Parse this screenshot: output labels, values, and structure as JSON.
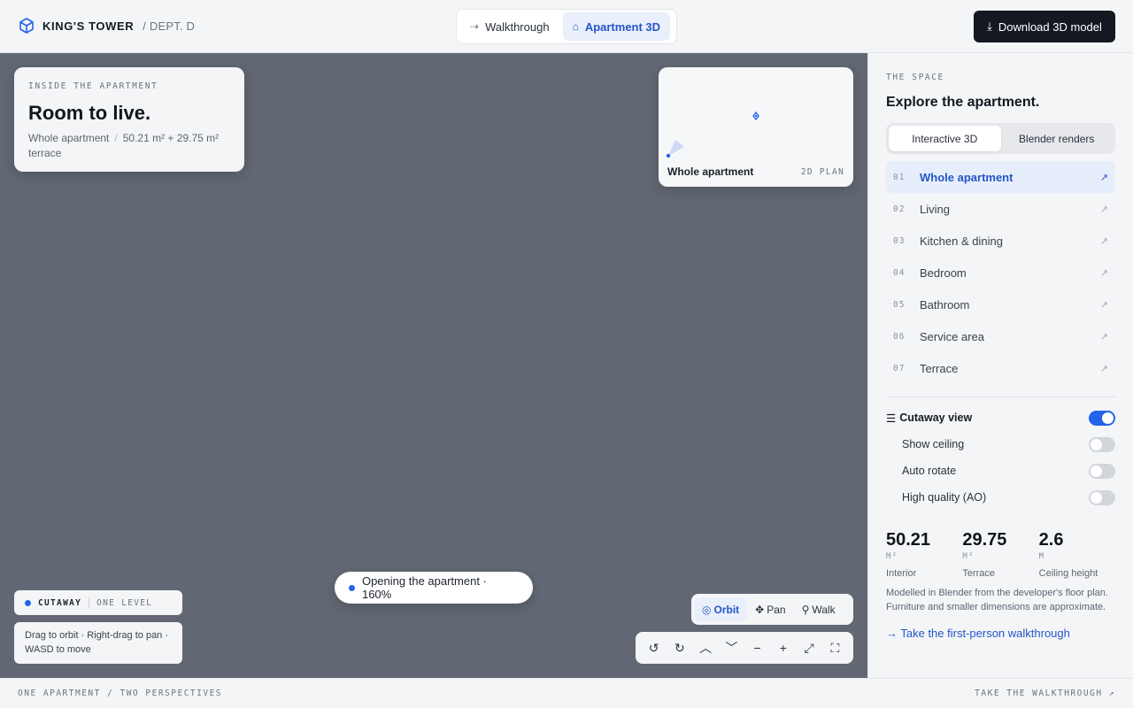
{
  "header": {
    "title": "KING'S TOWER",
    "subtitle": "/ DEPT. D",
    "mode_tabs": [
      {
        "label": "Walkthrough",
        "icon": "dashed-arrow-icon"
      },
      {
        "label": "Apartment 3D",
        "icon": "house-icon"
      }
    ],
    "download_label": "Download 3D model"
  },
  "viewport": {
    "info_card": {
      "eyebrow": "INSIDE THE APARTMENT",
      "title": "Room to live.",
      "meta_name": "Whole apartment",
      "meta_sep": "/",
      "meta_area": "50.21 m² + 29.75 m² terrace"
    },
    "minimap": {
      "label": "Whole apartment",
      "tag": "2D PLAN"
    },
    "cutaway_chip": {
      "label": "CUTAWAY",
      "level": "ONE LEVEL"
    },
    "hint": "Drag to orbit · Right-drag to pan · WASD to move",
    "toast": "Opening the apartment · 160%",
    "nav_modes": [
      {
        "label": "Orbit",
        "icon": "◎"
      },
      {
        "label": "Pan",
        "icon": "✥"
      },
      {
        "label": "Walk",
        "icon": "⚲"
      }
    ],
    "tools": [
      {
        "name": "rotate-left-icon",
        "glyph": "↺"
      },
      {
        "name": "rotate-right-icon",
        "glyph": "↻"
      },
      {
        "name": "tilt-up-icon",
        "glyph": "︿"
      },
      {
        "name": "tilt-down-icon",
        "glyph": "﹀"
      },
      {
        "name": "zoom-out-icon",
        "glyph": "−"
      },
      {
        "name": "zoom-in-icon",
        "glyph": "+"
      },
      {
        "name": "fit-view-icon",
        "glyph": "⤢"
      },
      {
        "name": "fullscreen-icon",
        "glyph": "⛶"
      }
    ]
  },
  "sidebar": {
    "eyebrow": "THE SPACE",
    "title": "Explore the apartment.",
    "tabs": [
      "Interactive 3D",
      "Blender renders"
    ],
    "rooms": [
      {
        "num": "01",
        "label": "Whole apartment"
      },
      {
        "num": "02",
        "label": "Living"
      },
      {
        "num": "03",
        "label": "Kitchen & dining"
      },
      {
        "num": "04",
        "label": "Bedroom"
      },
      {
        "num": "05",
        "label": "Bathroom"
      },
      {
        "num": "06",
        "label": "Service area"
      },
      {
        "num": "07",
        "label": "Terrace"
      }
    ],
    "cutaway": {
      "label": "Cutaway view",
      "on": true
    },
    "options": [
      {
        "label": "Show ceiling",
        "on": false
      },
      {
        "label": "Auto rotate",
        "on": false
      },
      {
        "label": "High quality (AO)",
        "on": false
      }
    ],
    "stats": [
      {
        "value": "50.21",
        "unit": "M²",
        "label": "Interior"
      },
      {
        "value": "29.75",
        "unit": "M²",
        "label": "Terrace"
      },
      {
        "value": "2.6",
        "unit": "M",
        "label": "Ceiling height"
      }
    ],
    "note": "Modelled in Blender from the developer's floor plan. Furniture and smaller dimensions are approximate.",
    "walk_link": "→ Take the first-person walkthrough"
  },
  "footer": {
    "left": "ONE APARTMENT / TWO PERSPECTIVES",
    "right": "TAKE THE WALKTHROUGH ↗"
  },
  "colors": {
    "accent": "#2563eb",
    "accent_text": "#2456c8",
    "viewport_bg": "#616873",
    "dark_button": "#141821"
  }
}
